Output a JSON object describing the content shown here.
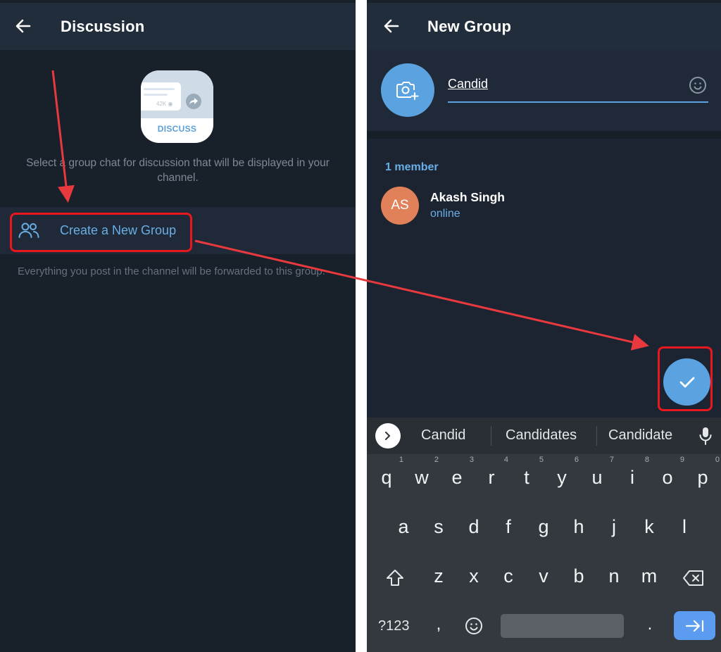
{
  "left_screen": {
    "title": "Discussion",
    "illustration": {
      "views": "42K",
      "label": "DISCUSS"
    },
    "help_text": "Select a group chat for discussion that will be displayed in your channel.",
    "create_group_label": "Create a New Group",
    "footer_text": "Everything you post in the channel will be forwarded to this group."
  },
  "right_screen": {
    "title": "New Group",
    "group_name_value": "Candid",
    "members_header": "1 member",
    "members": [
      {
        "initials": "AS",
        "name": "Akash Singh",
        "status": "online",
        "avatar_color": "#e0815a"
      }
    ]
  },
  "keyboard": {
    "suggestions": [
      "Candid",
      "Candidates",
      "Candidate"
    ],
    "row1": [
      {
        "key": "q",
        "hint": "1"
      },
      {
        "key": "w",
        "hint": "2"
      },
      {
        "key": "e",
        "hint": "3"
      },
      {
        "key": "r",
        "hint": "4"
      },
      {
        "key": "t",
        "hint": "5"
      },
      {
        "key": "y",
        "hint": "6"
      },
      {
        "key": "u",
        "hint": "7"
      },
      {
        "key": "i",
        "hint": "8"
      },
      {
        "key": "o",
        "hint": "9"
      },
      {
        "key": "p",
        "hint": "0"
      }
    ],
    "row2": [
      "a",
      "s",
      "d",
      "f",
      "g",
      "h",
      "j",
      "k",
      "l"
    ],
    "row3": [
      "z",
      "x",
      "c",
      "v",
      "b",
      "n",
      "m"
    ],
    "symbols_label": "?123",
    "comma": ",",
    "period": "."
  },
  "colors": {
    "accent": "#5aa2e0",
    "link": "#69aee6",
    "annotation": "#e8181e",
    "background": "#18202a",
    "appbar": "#212d3b"
  }
}
